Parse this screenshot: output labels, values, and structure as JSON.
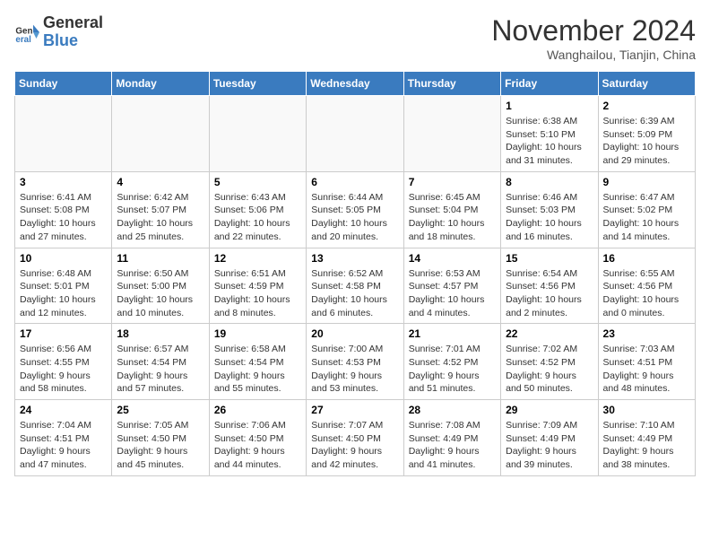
{
  "header": {
    "logo": {
      "general": "General",
      "blue": "Blue"
    },
    "title": "November 2024",
    "subtitle": "Wanghailou, Tianjin, China"
  },
  "days_of_week": [
    "Sunday",
    "Monday",
    "Tuesday",
    "Wednesday",
    "Thursday",
    "Friday",
    "Saturday"
  ],
  "weeks": [
    [
      {
        "day": "",
        "info": ""
      },
      {
        "day": "",
        "info": ""
      },
      {
        "day": "",
        "info": ""
      },
      {
        "day": "",
        "info": ""
      },
      {
        "day": "",
        "info": ""
      },
      {
        "day": "1",
        "info": "Sunrise: 6:38 AM\nSunset: 5:10 PM\nDaylight: 10 hours\nand 31 minutes."
      },
      {
        "day": "2",
        "info": "Sunrise: 6:39 AM\nSunset: 5:09 PM\nDaylight: 10 hours\nand 29 minutes."
      }
    ],
    [
      {
        "day": "3",
        "info": "Sunrise: 6:41 AM\nSunset: 5:08 PM\nDaylight: 10 hours\nand 27 minutes."
      },
      {
        "day": "4",
        "info": "Sunrise: 6:42 AM\nSunset: 5:07 PM\nDaylight: 10 hours\nand 25 minutes."
      },
      {
        "day": "5",
        "info": "Sunrise: 6:43 AM\nSunset: 5:06 PM\nDaylight: 10 hours\nand 22 minutes."
      },
      {
        "day": "6",
        "info": "Sunrise: 6:44 AM\nSunset: 5:05 PM\nDaylight: 10 hours\nand 20 minutes."
      },
      {
        "day": "7",
        "info": "Sunrise: 6:45 AM\nSunset: 5:04 PM\nDaylight: 10 hours\nand 18 minutes."
      },
      {
        "day": "8",
        "info": "Sunrise: 6:46 AM\nSunset: 5:03 PM\nDaylight: 10 hours\nand 16 minutes."
      },
      {
        "day": "9",
        "info": "Sunrise: 6:47 AM\nSunset: 5:02 PM\nDaylight: 10 hours\nand 14 minutes."
      }
    ],
    [
      {
        "day": "10",
        "info": "Sunrise: 6:48 AM\nSunset: 5:01 PM\nDaylight: 10 hours\nand 12 minutes."
      },
      {
        "day": "11",
        "info": "Sunrise: 6:50 AM\nSunset: 5:00 PM\nDaylight: 10 hours\nand 10 minutes."
      },
      {
        "day": "12",
        "info": "Sunrise: 6:51 AM\nSunset: 4:59 PM\nDaylight: 10 hours\nand 8 minutes."
      },
      {
        "day": "13",
        "info": "Sunrise: 6:52 AM\nSunset: 4:58 PM\nDaylight: 10 hours\nand 6 minutes."
      },
      {
        "day": "14",
        "info": "Sunrise: 6:53 AM\nSunset: 4:57 PM\nDaylight: 10 hours\nand 4 minutes."
      },
      {
        "day": "15",
        "info": "Sunrise: 6:54 AM\nSunset: 4:56 PM\nDaylight: 10 hours\nand 2 minutes."
      },
      {
        "day": "16",
        "info": "Sunrise: 6:55 AM\nSunset: 4:56 PM\nDaylight: 10 hours\nand 0 minutes."
      }
    ],
    [
      {
        "day": "17",
        "info": "Sunrise: 6:56 AM\nSunset: 4:55 PM\nDaylight: 9 hours\nand 58 minutes."
      },
      {
        "day": "18",
        "info": "Sunrise: 6:57 AM\nSunset: 4:54 PM\nDaylight: 9 hours\nand 57 minutes."
      },
      {
        "day": "19",
        "info": "Sunrise: 6:58 AM\nSunset: 4:54 PM\nDaylight: 9 hours\nand 55 minutes."
      },
      {
        "day": "20",
        "info": "Sunrise: 7:00 AM\nSunset: 4:53 PM\nDaylight: 9 hours\nand 53 minutes."
      },
      {
        "day": "21",
        "info": "Sunrise: 7:01 AM\nSunset: 4:52 PM\nDaylight: 9 hours\nand 51 minutes."
      },
      {
        "day": "22",
        "info": "Sunrise: 7:02 AM\nSunset: 4:52 PM\nDaylight: 9 hours\nand 50 minutes."
      },
      {
        "day": "23",
        "info": "Sunrise: 7:03 AM\nSunset: 4:51 PM\nDaylight: 9 hours\nand 48 minutes."
      }
    ],
    [
      {
        "day": "24",
        "info": "Sunrise: 7:04 AM\nSunset: 4:51 PM\nDaylight: 9 hours\nand 47 minutes."
      },
      {
        "day": "25",
        "info": "Sunrise: 7:05 AM\nSunset: 4:50 PM\nDaylight: 9 hours\nand 45 minutes."
      },
      {
        "day": "26",
        "info": "Sunrise: 7:06 AM\nSunset: 4:50 PM\nDaylight: 9 hours\nand 44 minutes."
      },
      {
        "day": "27",
        "info": "Sunrise: 7:07 AM\nSunset: 4:50 PM\nDaylight: 9 hours\nand 42 minutes."
      },
      {
        "day": "28",
        "info": "Sunrise: 7:08 AM\nSunset: 4:49 PM\nDaylight: 9 hours\nand 41 minutes."
      },
      {
        "day": "29",
        "info": "Sunrise: 7:09 AM\nSunset: 4:49 PM\nDaylight: 9 hours\nand 39 minutes."
      },
      {
        "day": "30",
        "info": "Sunrise: 7:10 AM\nSunset: 4:49 PM\nDaylight: 9 hours\nand 38 minutes."
      }
    ]
  ]
}
